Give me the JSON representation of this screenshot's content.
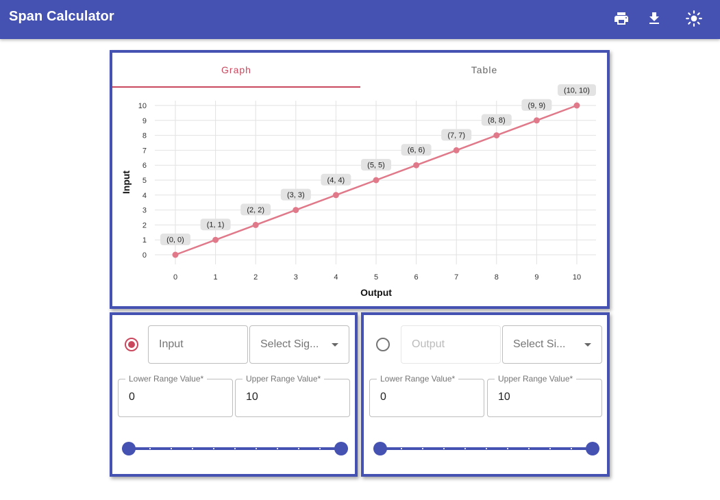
{
  "app": {
    "title": "Span Calculator",
    "colors": {
      "primary": "#4652b1",
      "accent": "#c9485e",
      "line": "#e07a8a"
    },
    "icons": [
      "print-icon",
      "download-icon",
      "brightness-icon"
    ]
  },
  "tabs": [
    {
      "label": "Graph",
      "active": true
    },
    {
      "label": "Table",
      "active": false
    }
  ],
  "chart_data": {
    "type": "line",
    "title": "",
    "xlabel": "Output",
    "ylabel": "Input",
    "x": [
      0,
      1,
      2,
      3,
      4,
      5,
      6,
      7,
      8,
      9,
      10
    ],
    "y": [
      0,
      1,
      2,
      3,
      4,
      5,
      6,
      7,
      8,
      9,
      10
    ],
    "point_labels": [
      "(0, 0)",
      "(1, 1)",
      "(2, 2)",
      "(3, 3)",
      "(4, 4)",
      "(5, 5)",
      "(6, 6)",
      "(7, 7)",
      "(8, 8)",
      "(9, 9)",
      "(10, 10)"
    ],
    "xlim": [
      0,
      10
    ],
    "ylim": [
      0,
      10
    ],
    "x_ticks": [
      0,
      1,
      2,
      3,
      4,
      5,
      6,
      7,
      8,
      9,
      10
    ],
    "y_ticks": [
      0,
      1,
      2,
      3,
      4,
      5,
      6,
      7,
      8,
      9,
      10
    ],
    "grid": true,
    "series_color": "#e07a8a"
  },
  "input_panel": {
    "selected": true,
    "name_placeholder": "Input",
    "signal_select": "Select Sig...",
    "lower_label": "Lower Range Value*",
    "lower_value": "0",
    "upper_label": "Upper Range Value*",
    "upper_value": "10",
    "slider": {
      "min": 0,
      "max": 10,
      "low": 0,
      "high": 10,
      "steps": 10
    }
  },
  "output_panel": {
    "selected": false,
    "name_placeholder": "Output",
    "signal_select": "Select Si...",
    "lower_label": "Lower Range Value*",
    "lower_value": "0",
    "upper_label": "Upper Range Value*",
    "upper_value": "10",
    "slider": {
      "min": 0,
      "max": 10,
      "low": 0,
      "high": 10,
      "steps": 10
    }
  }
}
